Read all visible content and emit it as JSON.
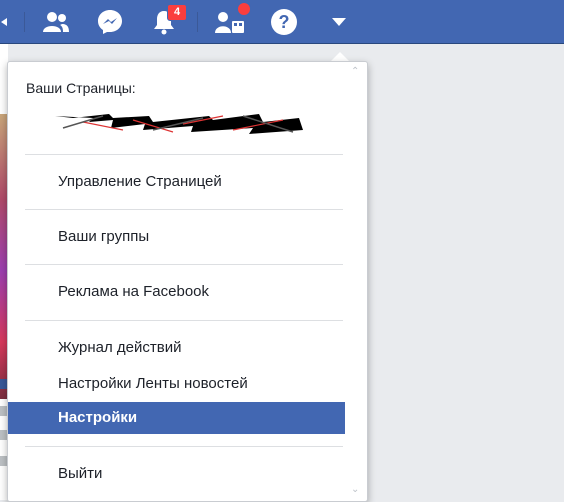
{
  "topbar": {
    "notifications_count": "4",
    "icons": [
      "home-icon",
      "friend-requests-icon",
      "messenger-icon",
      "notifications-icon",
      "quick-help-icon",
      "help-icon",
      "account-menu-icon"
    ]
  },
  "menu": {
    "section_title": "Ваши Страницы:",
    "items": [
      {
        "label": "Управление Страницей"
      },
      {
        "label": "Ваши группы"
      },
      {
        "label": "Реклама на Facebook"
      },
      {
        "label": "Журнал действий"
      },
      {
        "label": "Настройки Ленты новостей"
      },
      {
        "label": "Настройки"
      },
      {
        "label": "Выйти"
      }
    ]
  },
  "colors": {
    "brand": "#4267b2",
    "badge": "#fa3e3e",
    "highlight": "#4267b2"
  }
}
